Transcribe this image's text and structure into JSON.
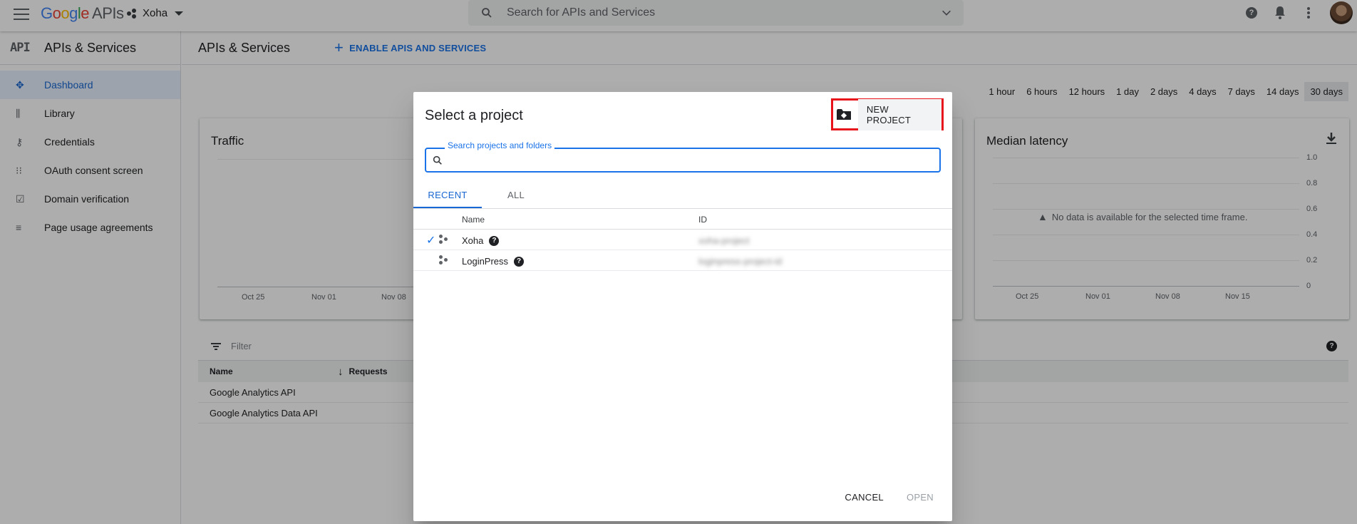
{
  "topbar": {
    "logo_google": "Google",
    "logo_apis": "APIs",
    "project_name": "Xoha",
    "search_placeholder": "Search for APIs and Services"
  },
  "sidebar": {
    "title": "APIs & Services",
    "api_mark": "API",
    "items": [
      {
        "label": "Dashboard",
        "icon": "dashboard-icon",
        "active": true
      },
      {
        "label": "Library",
        "icon": "library-icon",
        "active": false
      },
      {
        "label": "Credentials",
        "icon": "key-icon",
        "active": false
      },
      {
        "label": "OAuth consent screen",
        "icon": "consent-icon",
        "active": false
      },
      {
        "label": "Domain verification",
        "icon": "checkbox-icon",
        "active": false
      },
      {
        "label": "Page usage agreements",
        "icon": "settings-list-icon",
        "active": false
      }
    ]
  },
  "main": {
    "title": "APIs & Services",
    "enable_button": "ENABLE APIS AND SERVICES",
    "time_ranges": [
      "1 hour",
      "6 hours",
      "12 hours",
      "1 day",
      "2 days",
      "4 days",
      "7 days",
      "14 days",
      "30 days"
    ],
    "selected_time_range": "30 days",
    "traffic_card": {
      "title": "Traffic",
      "x_ticks": [
        "Oct 25",
        "Nov 01",
        "Nov 08"
      ]
    },
    "latency_card": {
      "title": "Median latency",
      "no_data": "No data is available for the selected time frame.",
      "x_ticks": [
        "Oct 25",
        "Nov 01",
        "Nov 08",
        "Nov 15"
      ],
      "y_ticks": [
        "1.0",
        "0.8",
        "0.6",
        "0.4",
        "0.2",
        "0"
      ]
    },
    "filter_placeholder": "Filter",
    "table": {
      "headers": [
        "Name",
        "Requests"
      ],
      "rows": [
        "Google Analytics API",
        "Google Analytics Data API"
      ]
    }
  },
  "dialog": {
    "title": "Select a project",
    "new_project": "NEW PROJECT",
    "search_label": "Search projects and folders",
    "tabs": [
      "RECENT",
      "ALL"
    ],
    "active_tab": "RECENT",
    "columns": {
      "name": "Name",
      "id": "ID"
    },
    "projects": [
      {
        "name": "Xoha",
        "id": "xoha-project",
        "selected": true
      },
      {
        "name": "LoginPress",
        "id": "loginpress-project-id",
        "selected": false
      }
    ],
    "cancel": "CANCEL",
    "open": "OPEN"
  },
  "colors": {
    "accent": "#1a73e8",
    "highlight_border": "#e8141b",
    "scrim": "rgba(0,0,0,0.32)"
  }
}
